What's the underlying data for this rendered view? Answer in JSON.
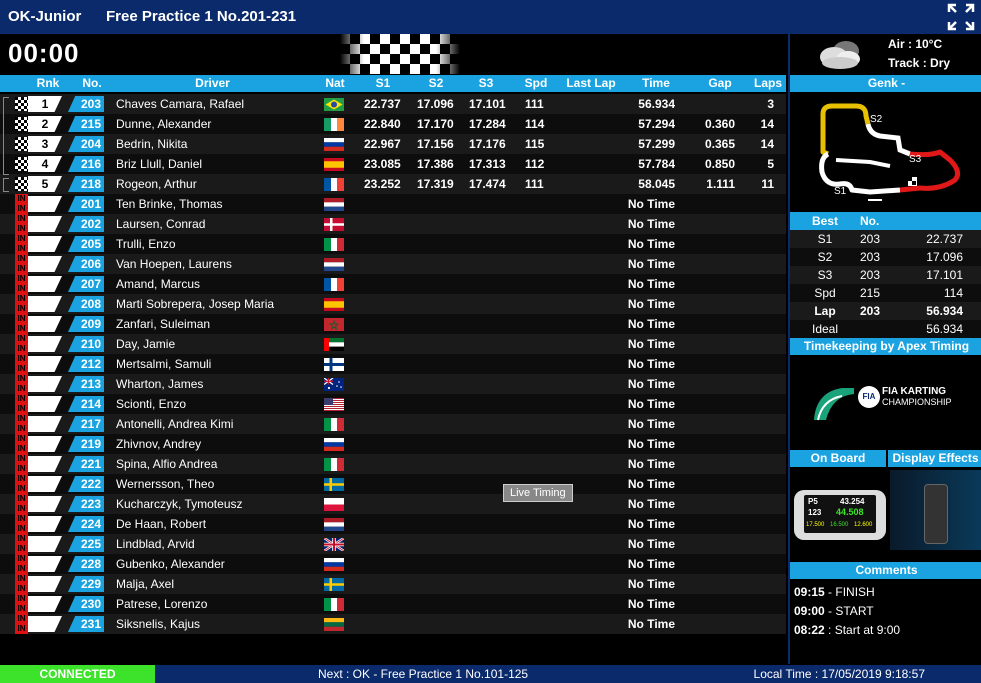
{
  "header": {
    "series": "OK-Junior",
    "session": "Free Practice 1 No.201-231"
  },
  "timer": "00:00",
  "columns": {
    "rnk": "Rnk",
    "no": "No.",
    "driver": "Driver",
    "nat": "Nat",
    "s1": "S1",
    "s2": "S2",
    "s3": "S3",
    "spd": "Spd",
    "last": "Last Lap",
    "time": "Time",
    "gap": "Gap",
    "laps": "Laps"
  },
  "rows": [
    {
      "rnk": "1",
      "no": "203",
      "driver": "Chaves Camara, Rafael",
      "nat": "br",
      "s1": "22.737",
      "s2": "17.096",
      "s3": "17.101",
      "spd": "111",
      "last": "",
      "time": "56.934",
      "gap": "",
      "laps": "3"
    },
    {
      "rnk": "2",
      "no": "215",
      "driver": "Dunne, Alexander",
      "nat": "ie",
      "s1": "22.840",
      "s2": "17.170",
      "s3": "17.284",
      "spd": "114",
      "last": "",
      "time": "57.294",
      "gap": "0.360",
      "laps": "14"
    },
    {
      "rnk": "3",
      "no": "204",
      "driver": "Bedrin, Nikita",
      "nat": "ru",
      "s1": "22.967",
      "s2": "17.156",
      "s3": "17.176",
      "spd": "115",
      "last": "",
      "time": "57.299",
      "gap": "0.365",
      "laps": "14"
    },
    {
      "rnk": "4",
      "no": "216",
      "driver": "Briz Llull, Daniel",
      "nat": "es",
      "s1": "23.085",
      "s2": "17.386",
      "s3": "17.313",
      "spd": "112",
      "last": "",
      "time": "57.784",
      "gap": "0.850",
      "laps": "5"
    },
    {
      "rnk": "5",
      "no": "218",
      "driver": "Rogeon, Arthur",
      "nat": "fr",
      "s1": "23.252",
      "s2": "17.319",
      "s3": "17.474",
      "spd": "111",
      "last": "",
      "time": "58.045",
      "gap": "1.111",
      "laps": "11"
    },
    {
      "rnk": "",
      "no": "201",
      "driver": "Ten Brinke, Thomas",
      "nat": "nl",
      "time": "No Time"
    },
    {
      "rnk": "",
      "no": "202",
      "driver": "Laursen, Conrad",
      "nat": "dk",
      "time": "No Time"
    },
    {
      "rnk": "",
      "no": "205",
      "driver": "Trulli, Enzo",
      "nat": "it",
      "time": "No Time"
    },
    {
      "rnk": "",
      "no": "206",
      "driver": "Van Hoepen, Laurens",
      "nat": "nl",
      "time": "No Time"
    },
    {
      "rnk": "",
      "no": "207",
      "driver": "Amand, Marcus",
      "nat": "fr",
      "time": "No Time"
    },
    {
      "rnk": "",
      "no": "208",
      "driver": "Marti Sobrepera, Josep Maria",
      "nat": "es",
      "time": "No Time"
    },
    {
      "rnk": "",
      "no": "209",
      "driver": "Zanfari, Suleiman",
      "nat": "ma",
      "time": "No Time"
    },
    {
      "rnk": "",
      "no": "210",
      "driver": "Day, Jamie",
      "nat": "ae",
      "time": "No Time"
    },
    {
      "rnk": "",
      "no": "212",
      "driver": "Mertsalmi, Samuli",
      "nat": "fi",
      "time": "No Time"
    },
    {
      "rnk": "",
      "no": "213",
      "driver": "Wharton, James",
      "nat": "au",
      "time": "No Time"
    },
    {
      "rnk": "",
      "no": "214",
      "driver": "Scionti, Enzo",
      "nat": "us",
      "time": "No Time"
    },
    {
      "rnk": "",
      "no": "217",
      "driver": "Antonelli, Andrea Kimi",
      "nat": "it",
      "time": "No Time"
    },
    {
      "rnk": "",
      "no": "219",
      "driver": "Zhivnov, Andrey",
      "nat": "ru",
      "time": "No Time"
    },
    {
      "rnk": "",
      "no": "221",
      "driver": "Spina, Alfio Andrea",
      "nat": "it",
      "time": "No Time"
    },
    {
      "rnk": "",
      "no": "222",
      "driver": "Wernersson, Theo",
      "nat": "se",
      "time": "No Time"
    },
    {
      "rnk": "",
      "no": "223",
      "driver": "Kucharczyk, Tymoteusz",
      "nat": "pl",
      "time": "No Time"
    },
    {
      "rnk": "",
      "no": "224",
      "driver": "De Haan, Robert",
      "nat": "nl",
      "time": "No Time"
    },
    {
      "rnk": "",
      "no": "225",
      "driver": "Lindblad, Arvid",
      "nat": "gb",
      "time": "No Time"
    },
    {
      "rnk": "",
      "no": "228",
      "driver": "Gubenko, Alexander",
      "nat": "ru",
      "time": "No Time"
    },
    {
      "rnk": "",
      "no": "229",
      "driver": "Malja, Axel",
      "nat": "se",
      "time": "No Time"
    },
    {
      "rnk": "",
      "no": "230",
      "driver": "Patrese, Lorenzo",
      "nat": "it",
      "time": "No Time"
    },
    {
      "rnk": "",
      "no": "231",
      "driver": "Siksnelis, Kajus",
      "nat": "lt",
      "time": "No Time"
    }
  ],
  "pit_label": "IN",
  "weather": {
    "air": "Air : 10°C",
    "track": "Track : Dry",
    "icon": "cloud-icon"
  },
  "track": {
    "name": "Genk -",
    "s1": "S1",
    "s2": "S2",
    "s3": "S3"
  },
  "best": {
    "headers": [
      "Best",
      "No.",
      ""
    ],
    "rows": [
      [
        "S1",
        "203",
        "22.737"
      ],
      [
        "S2",
        "203",
        "17.096"
      ],
      [
        "S3",
        "203",
        "17.101"
      ],
      [
        "Spd",
        "215",
        "114"
      ],
      [
        "Lap",
        "203",
        "56.934"
      ],
      [
        "Ideal",
        "",
        "56.934"
      ]
    ]
  },
  "timekeeping": "Timekeeping by Apex Timing",
  "fia": {
    "line1": "FIA KARTING",
    "line2": "CHAMPIONSHIP",
    "badge": "FIA"
  },
  "onboard": "On Board",
  "display_effects": "Display Effects",
  "onboard_phone": {
    "pos": "P5",
    "time1": "43.254",
    "num": "123",
    "time2": "44.508",
    "s1": "17.500",
    "s2": "16.500",
    "s3": "12.600"
  },
  "comments_title": "Comments",
  "comments": [
    {
      "time": "09:15",
      "text": " - FINISH"
    },
    {
      "time": "09:00",
      "text": " - START"
    },
    {
      "time": "08:22",
      "text": " : Start at 9:00"
    }
  ],
  "status": "CONNECTED",
  "next": "Next : OK - Free Practice 1 No.101-125",
  "local_time": "Local Time : 17/05/2019 9:18:57",
  "tooltip": "Live Timing",
  "colors": {
    "header_bg": "#0a2a6b",
    "accent": "#1aa3e0",
    "connected": "#3ce32a",
    "pit": "#d11"
  }
}
